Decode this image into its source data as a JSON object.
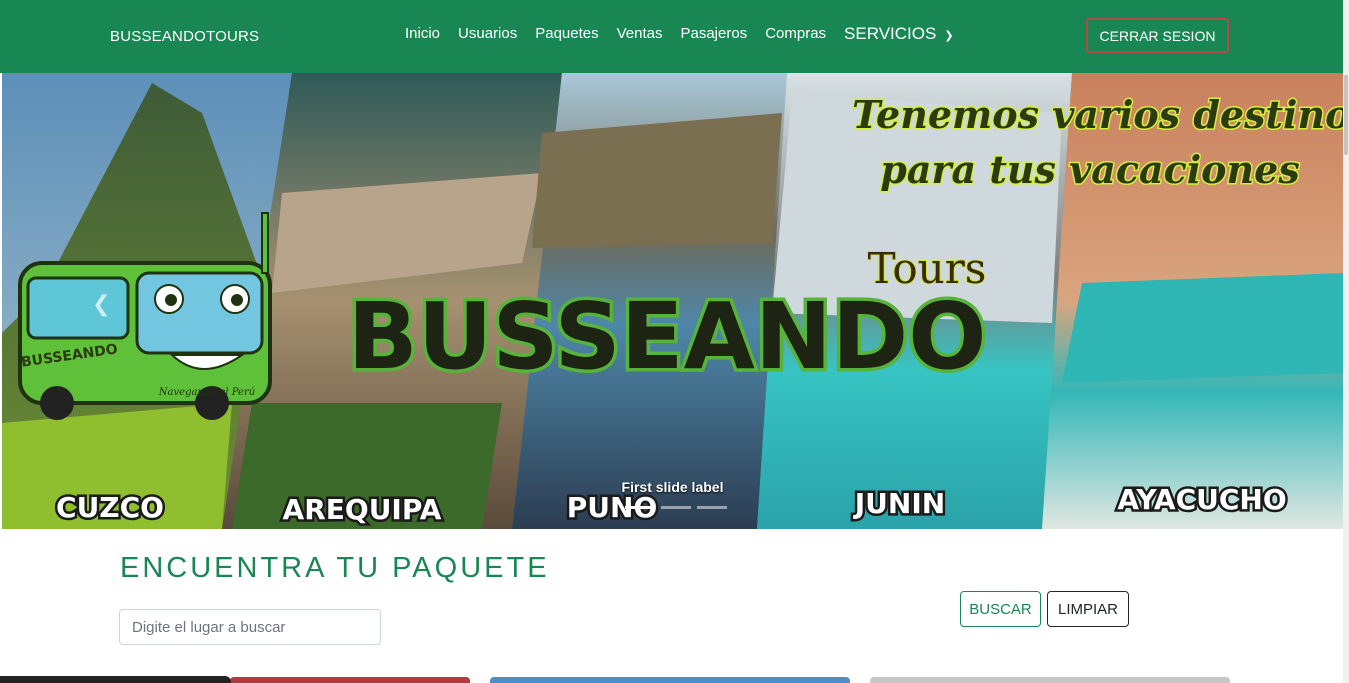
{
  "navbar": {
    "brand": "BUSSEANDOTOURS",
    "links": [
      "Inicio",
      "Usuarios",
      "Paquetes",
      "Ventas",
      "Pasajeros",
      "Compras"
    ],
    "dropdown_label": "SERVICIOS",
    "logout_label": "CERRAR SESION",
    "bg_color": "#198754"
  },
  "carousel": {
    "tagline_line1": "Tenemos varios destinos",
    "tagline_line2": "para tus vacaciones",
    "logo_main": "BUSSEANDO",
    "logo_sub": "Tours",
    "bus_name": "BUSSEANDO",
    "bus_slogan": "Navegando el Perú",
    "destinations": [
      "CUZCO",
      "AREQUIPA",
      "PUNO",
      "JUNIN",
      "AYACUCHO"
    ],
    "caption": "First slide label",
    "indicator_count": 3,
    "active_indicator": 0
  },
  "search": {
    "title": "ENCUENTRA TU PAQUETE",
    "placeholder": "Digite el lugar a buscar",
    "search_label": "BUSCAR",
    "clear_label": "LIMPIAR"
  },
  "colors": {
    "accent": "#198754",
    "logout_border": "#b54848"
  }
}
